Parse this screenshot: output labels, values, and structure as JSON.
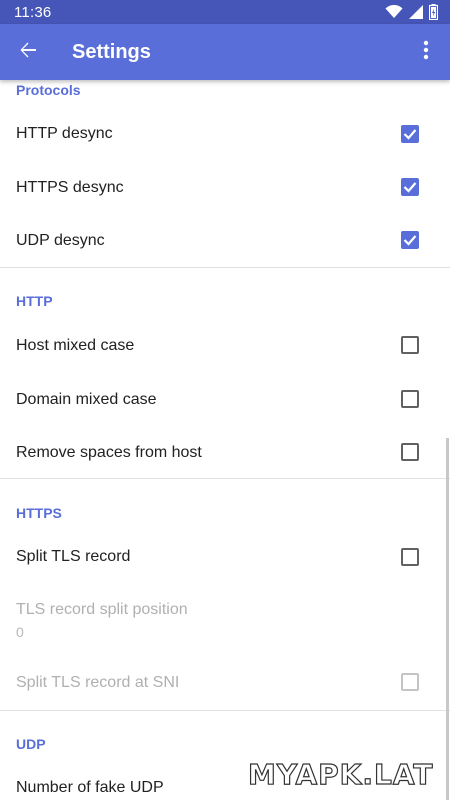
{
  "status_bar": {
    "time": "11:36",
    "icons": [
      "wifi-icon",
      "signal-icon",
      "battery-icon"
    ]
  },
  "app_bar": {
    "title": "Settings",
    "back_icon": "arrow-left-icon",
    "menu_icon": "more-vertical-icon"
  },
  "sections": {
    "protocols": {
      "header": "Protocols",
      "items": [
        {
          "label": "HTTP desync",
          "checked": true
        },
        {
          "label": "HTTPS desync",
          "checked": true
        },
        {
          "label": "UDP desync",
          "checked": true
        }
      ]
    },
    "http": {
      "header": "HTTP",
      "items": [
        {
          "label": "Host mixed case",
          "checked": false
        },
        {
          "label": "Domain mixed case",
          "checked": false
        },
        {
          "label": "Remove spaces from host",
          "checked": false
        }
      ]
    },
    "https": {
      "header": "HTTPS",
      "items": [
        {
          "label": "Split TLS record",
          "checked": false
        },
        {
          "label": "TLS record split position",
          "summary": "0",
          "enabled": false
        },
        {
          "label": "Split TLS record at SNI",
          "checked": false,
          "enabled": false
        }
      ]
    },
    "udp": {
      "header": "UDP",
      "items": [
        {
          "label": "Number of fake UDP"
        }
      ]
    }
  },
  "watermark": "MYAPK.LAT",
  "colors": {
    "status_bar": "#4656b8",
    "app_bar": "#5a6ed9",
    "accent": "#5a6ed9",
    "text": "#212121",
    "disabled_text": "#b0b0b0"
  }
}
